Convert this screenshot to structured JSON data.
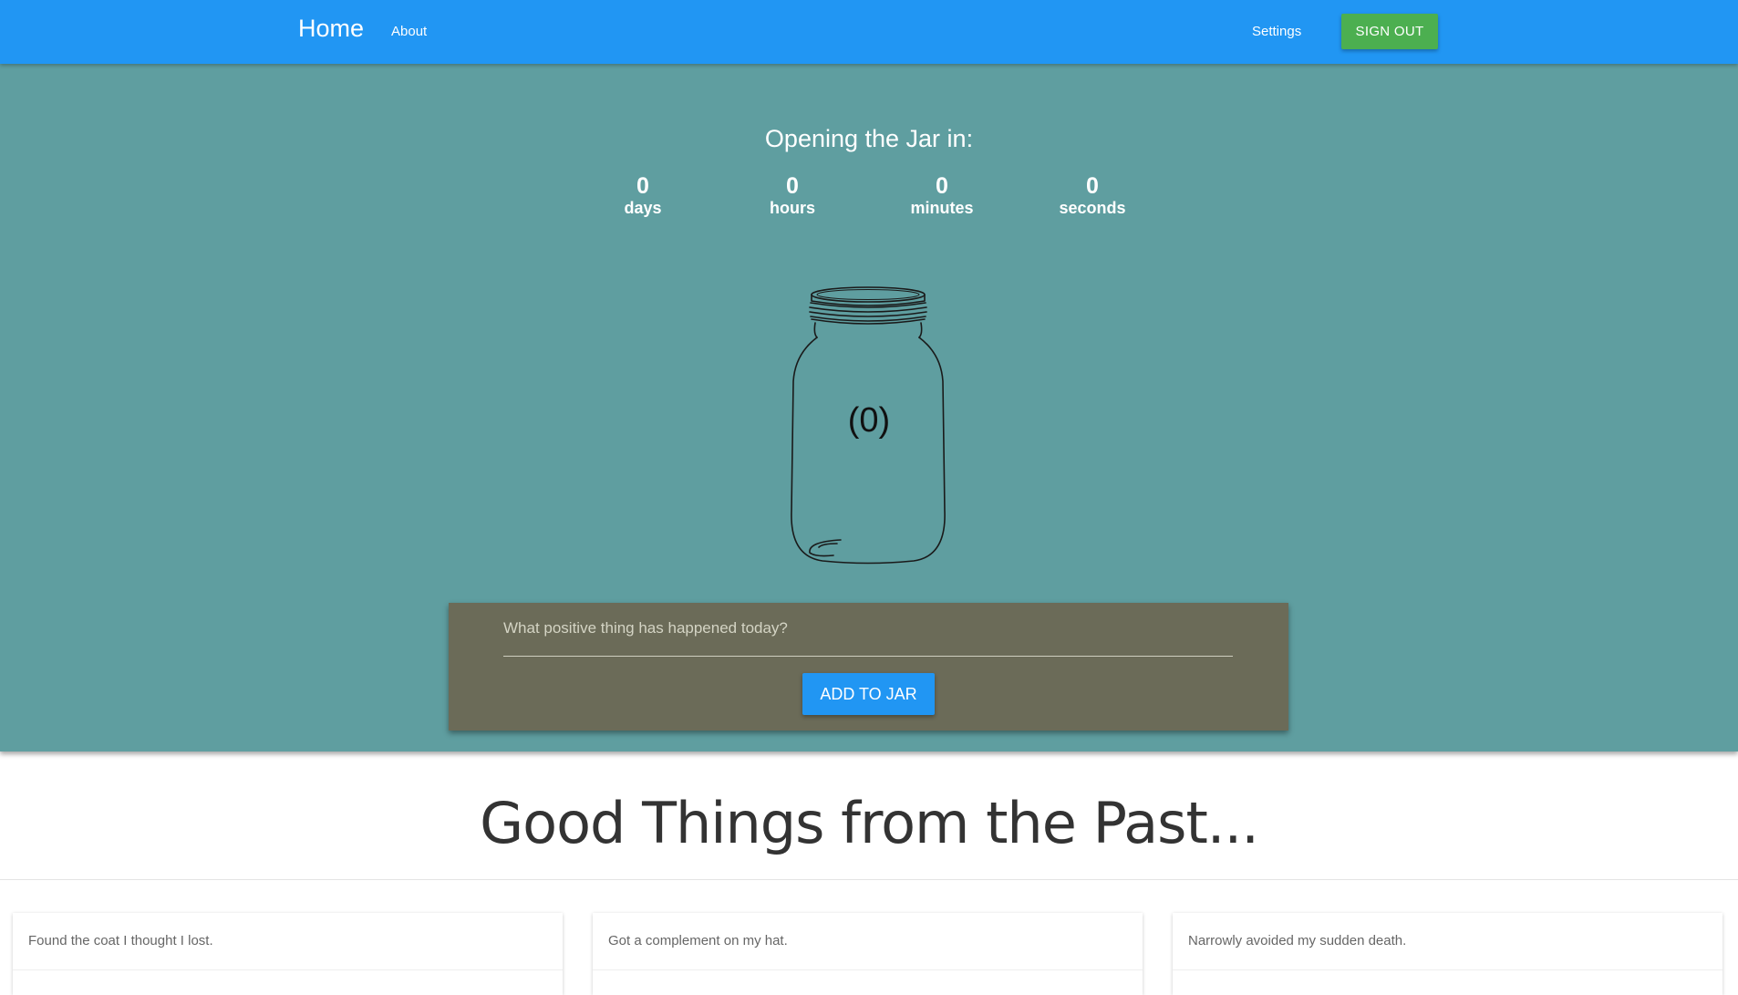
{
  "nav": {
    "brand": "Home",
    "about": "About",
    "settings": "Settings",
    "sign_out": "SIGN OUT"
  },
  "countdown": {
    "title": "Opening the Jar in:",
    "units": [
      {
        "value": "0",
        "label": "days"
      },
      {
        "value": "0",
        "label": "hours"
      },
      {
        "value": "0",
        "label": "minutes"
      },
      {
        "value": "0",
        "label": "seconds"
      }
    ]
  },
  "jar": {
    "count": "(0)"
  },
  "entry": {
    "placeholder": "What positive thing has happened today?",
    "button": "ADD TO JAR"
  },
  "past": {
    "title": "Good Things from the Past...",
    "items": [
      "Found the coat I thought I lost.",
      "Got a complement on my hat.",
      "Narrowly avoided my sudden death."
    ]
  },
  "colors": {
    "navbar": "#2196f3",
    "hero": "#5f9ea0",
    "entry_card": "#6b6b58",
    "sign_out": "#4caf50",
    "add_button": "#2196f3"
  }
}
